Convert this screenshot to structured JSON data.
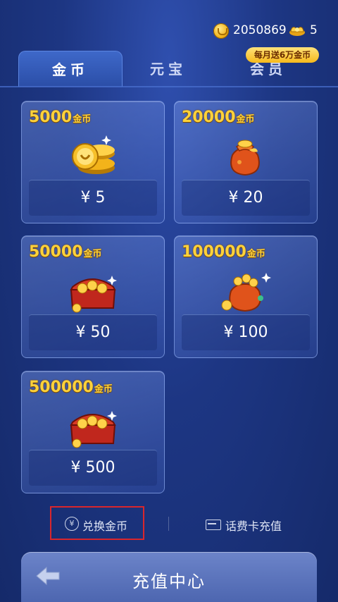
{
  "header": {
    "coin_icon": "gold-coin-icon",
    "coins": "2050869",
    "ingot_icon": "gold-ingot-icon",
    "ingots": "5"
  },
  "tabs": [
    {
      "label": "金币",
      "active": true
    },
    {
      "label": "元宝",
      "active": false
    },
    {
      "label": "会员",
      "active": false
    }
  ],
  "promo_badge": "每月送6万金币",
  "products": [
    {
      "amount": "5000",
      "unit": "金币",
      "price": "¥ 5",
      "art": "coin-stack-icon"
    },
    {
      "amount": "20000",
      "unit": "金币",
      "price": "¥ 20",
      "art": "money-bag-icon"
    },
    {
      "amount": "50000",
      "unit": "金币",
      "price": "¥ 50",
      "art": "treasure-chest-icon"
    },
    {
      "amount": "100000",
      "unit": "金币",
      "price": "¥ 100",
      "art": "big-money-bag-icon"
    },
    {
      "amount": "500000",
      "unit": "金币",
      "price": "¥ 500",
      "art": "treasure-chest-icon"
    }
  ],
  "footer_links": {
    "exchange": "兑换金币",
    "exchange_icon": "yuan-exchange-icon",
    "card_recharge": "话费卡充值",
    "card_icon": "card-icon"
  },
  "bottom_bar": {
    "title": "充值中心",
    "back_icon": "back-arrow-icon"
  },
  "colors": {
    "accent_gold": "#ffd23a",
    "background": "#1d3683",
    "highlight_box": "#d9262c"
  }
}
